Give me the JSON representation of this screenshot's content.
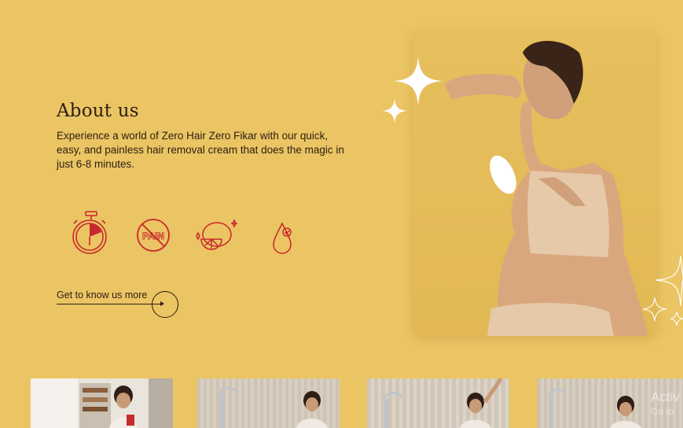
{
  "about": {
    "title": "About us",
    "description": "Experience a world of Zero Hair Zero Fikar with our quick, easy, and painless hair removal cream that does the magic in just 6-8 minutes."
  },
  "features": [
    {
      "icon": "stopwatch-icon"
    },
    {
      "icon": "no-pain-icon",
      "label": "PAIN"
    },
    {
      "icon": "lemon-icon"
    },
    {
      "icon": "drop-icon"
    }
  ],
  "cta": {
    "label": "Get to know us more"
  },
  "watermark": {
    "line1": "Activ",
    "line2": "Go to"
  },
  "colors": {
    "background": "#EBC463",
    "accent": "#C8282D",
    "text": "#2A1F12"
  }
}
